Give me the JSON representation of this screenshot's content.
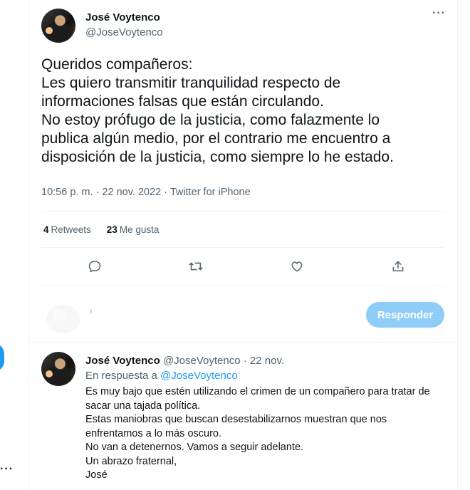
{
  "tweet": {
    "author_name": "José Voytenco",
    "author_handle": "@JoseVoytenco",
    "text_lines": [
      "Queridos compañeros:",
      "Les quiero transmitir tranquilidad respecto de",
      "informaciones falsas que están circulando.",
      "No estoy prófugo de la justicia, como falazmente lo",
      "publica algún medio, por el contrario me encuentro a",
      "disposición de la justicia, como siempre lo he estado."
    ],
    "meta": "10:56 p. m. · 22 nov. 2022 · Twitter for iPhone",
    "retweets_count": "4",
    "retweets_label": "Retweets",
    "likes_count": "23",
    "likes_label": "Me gusta",
    "more_label": "···"
  },
  "actions": {
    "icons": [
      "reply-icon",
      "retweet-icon",
      "like-icon",
      "share-icon"
    ]
  },
  "composer": {
    "reply_button_label": "Responder"
  },
  "reply": {
    "author_name": "José Voytenco",
    "author_handle": "@JoseVoytenco",
    "date": "· 22 nov.",
    "in_reply_prefix": "En respuesta a",
    "in_reply_handle": "@JoseVoytenco",
    "text_lines": [
      "Es muy bajo que estén utilizando el crimen de un compañero para tratar de",
      "sacar una tajada política.",
      "Estas maniobras que buscan desestabilizarnos muestran que nos",
      "enfrentamos a lo más oscuro.",
      "No van a detenernos. Vamos a seguir adelante.",
      "Un abrazo fraternal,",
      "José"
    ]
  },
  "sidebar": {
    "more_label": "···"
  },
  "colors": {
    "accent": "#1d9bf0",
    "button_disabled": "#8ecdf8",
    "muted_text": "#536471",
    "text": "#0f1419"
  }
}
